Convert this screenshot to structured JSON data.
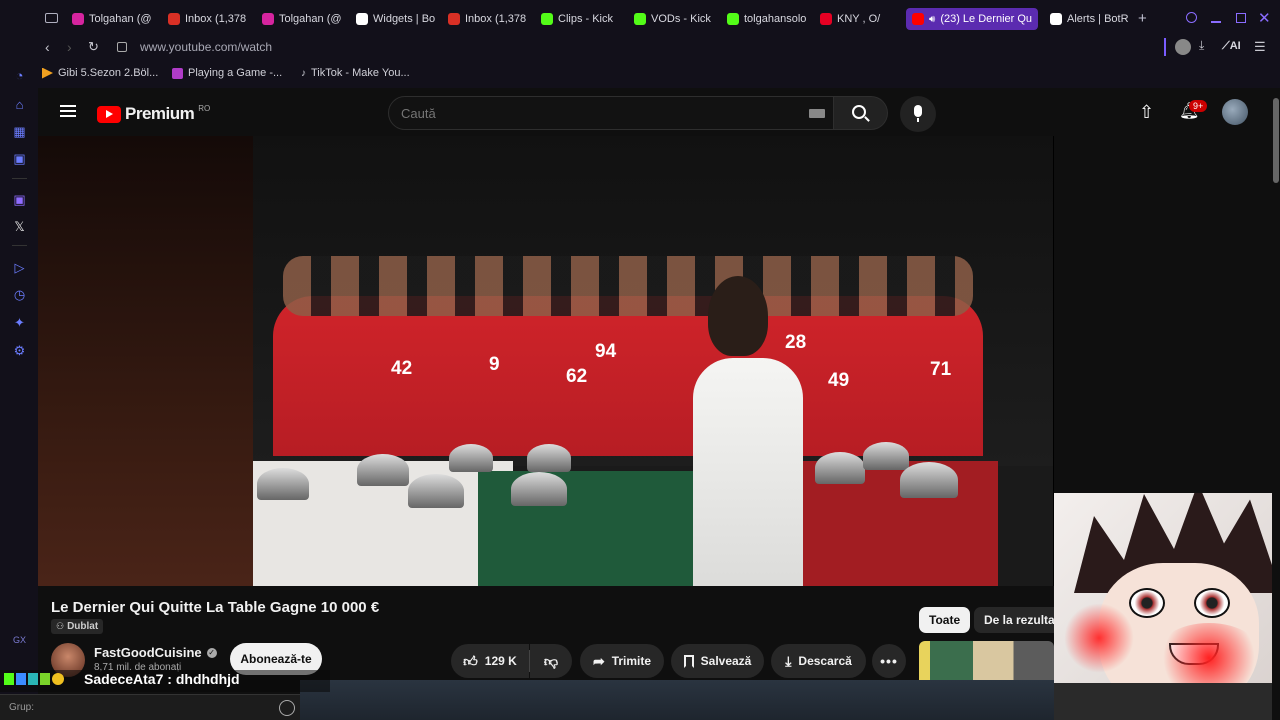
{
  "browser": {
    "tabs": [
      {
        "label": "Tolgahan (@",
        "color": "#d6249f"
      },
      {
        "label": "Inbox (1,378",
        "color": "#d93025"
      },
      {
        "label": "Tolgahan (@",
        "color": "#d6249f"
      },
      {
        "label": "Widgets | Bo",
        "color": "#ffffff"
      },
      {
        "label": "Inbox (1,378",
        "color": "#d93025"
      },
      {
        "label": "Clips - Kick",
        "color": "#53fc18"
      },
      {
        "label": "VODs - Kick",
        "color": "#53fc18"
      },
      {
        "label": "tolgahansolo",
        "color": "#53fc18"
      },
      {
        "label": "KNY , O/",
        "color": "#e60023"
      },
      {
        "label": "(23) Le Dernier Qu",
        "color": "#ff0000"
      },
      {
        "label": "Alerts | BotR",
        "color": "#ffffff"
      }
    ],
    "new_tab": "+",
    "url": "www.youtube.com/watch",
    "ai_label": "AI",
    "bookmarks": [
      {
        "label": "Gibi 5.Sezon 2.Böl..."
      },
      {
        "label": "Playing a Game -..."
      },
      {
        "label": "TikTok - Make You..."
      }
    ],
    "sidebar_badge": "GX"
  },
  "youtube": {
    "logo_text": "Premium",
    "region": "RO",
    "search_placeholder": "Caută",
    "notif_count": "9+",
    "video": {
      "title": "Le Dernier Qui Quitte La Table Gagne 10 000 €",
      "dub_badge": "Dublat",
      "channel": "FastGoodCuisine",
      "subscribers": "8,71 mil. de abonați",
      "subscribe_label": "Abonează-te",
      "likes": "129 K",
      "share_label": "Trimite",
      "save_label": "Salvează",
      "download_label": "Descarcă",
      "jersey_numbers": [
        "42",
        "9",
        "62",
        "94",
        "28",
        "49",
        "71"
      ]
    },
    "chips": [
      "Toate",
      "De la rezultat"
    ]
  },
  "overlay": {
    "chat_user": "SadeceAta7",
    "chat_message": "dhdhdhjd",
    "group_label": "Grup:"
  }
}
